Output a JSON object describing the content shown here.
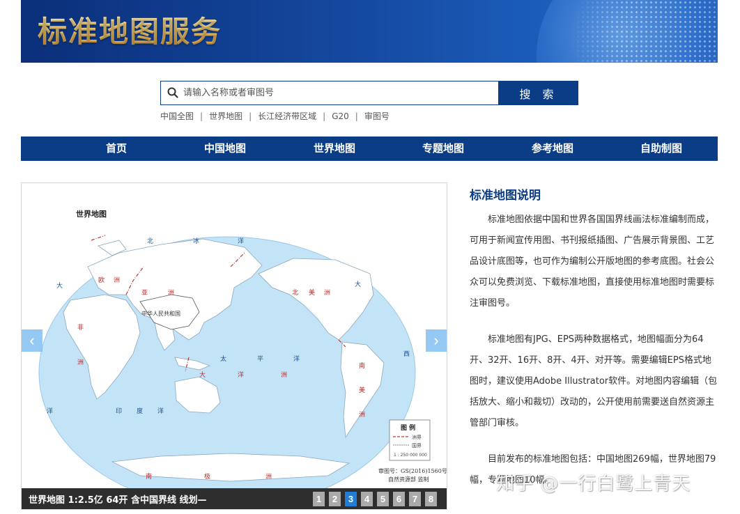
{
  "header": {
    "title": "标准地图服务"
  },
  "search": {
    "placeholder": "请输入名称或者审图号",
    "button_label": "搜 索",
    "quick_links": [
      "中国全图",
      "世界地图",
      "长江经济带区域",
      "G20",
      "审图号"
    ]
  },
  "nav": {
    "items": [
      "首页",
      "中国地图",
      "世界地图",
      "专题地图",
      "参考地图",
      "自助制图"
    ]
  },
  "carousel": {
    "map_title": "世界地图",
    "labels": {
      "arctic": [
        "北",
        "冰",
        "洋"
      ],
      "atlantic_left": "大",
      "atlantic_right": "大",
      "europe": [
        "欧",
        "洲"
      ],
      "asia": [
        "亚",
        "洲"
      ],
      "china": "中华人民共和国",
      "africa": [
        "非",
        "洲"
      ],
      "north_america": [
        "北",
        "美",
        "洲"
      ],
      "south_america": [
        "南",
        "美",
        "洲"
      ],
      "pacific": [
        "太",
        "平",
        "洋"
      ],
      "indian": [
        "印",
        "度",
        "洋"
      ],
      "oceania": [
        "大",
        "洋",
        "洲"
      ],
      "antarctica": [
        "南",
        "极",
        "洲"
      ],
      "west": "西",
      "atlantic_bottom": "洋"
    },
    "legend": {
      "title": "图  例",
      "line1": "洲界",
      "line2": "国界",
      "scale": "1 : 250 000 000"
    },
    "credit": {
      "review_no": "审图号：GS(2016)1560号",
      "org": "自然资源部  监制"
    },
    "caption": "世界地图 1:2.5亿 64开 含中国界线 线划—",
    "pages": [
      "1",
      "2",
      "3",
      "4",
      "5",
      "6",
      "7",
      "8"
    ],
    "active_page": "3",
    "prev_label": "‹",
    "next_label": "›"
  },
  "description": {
    "title": "标准地图说明",
    "paragraphs": [
      "标准地图依据中国和世界各国国界线画法标准编制而成，可用于新闻宣传用图、书刊报纸插图、广告展示背景图、工艺品设计底图等，也可作为编制公开版地图的参考底图。社会公众可以免费浏览、下载标准地图，直接使用标准地图时需要标注审图号。",
      "标准地图有JPG、EPS两种数据格式，地图幅面分为64开、32开、16开、8开、4开、对开等。需要编辑EPS格式地图时，建议使用Adobe Illustrator软件。对地图内容编辑（包括放大、缩小和裁切）改动的，公开使用前需要送自然资源主管部门审核。",
      "目前发布的标准地图包括：中国地图269幅，世界地图79幅，专题地图10幅。"
    ]
  },
  "watermark": "知乎 @一行白鹭上青天",
  "colors": {
    "brand": "#0b3d86",
    "ocean": "#c3e3f7",
    "active_page": "#1f7fd6",
    "caption_bar": "#2e2e2e"
  }
}
